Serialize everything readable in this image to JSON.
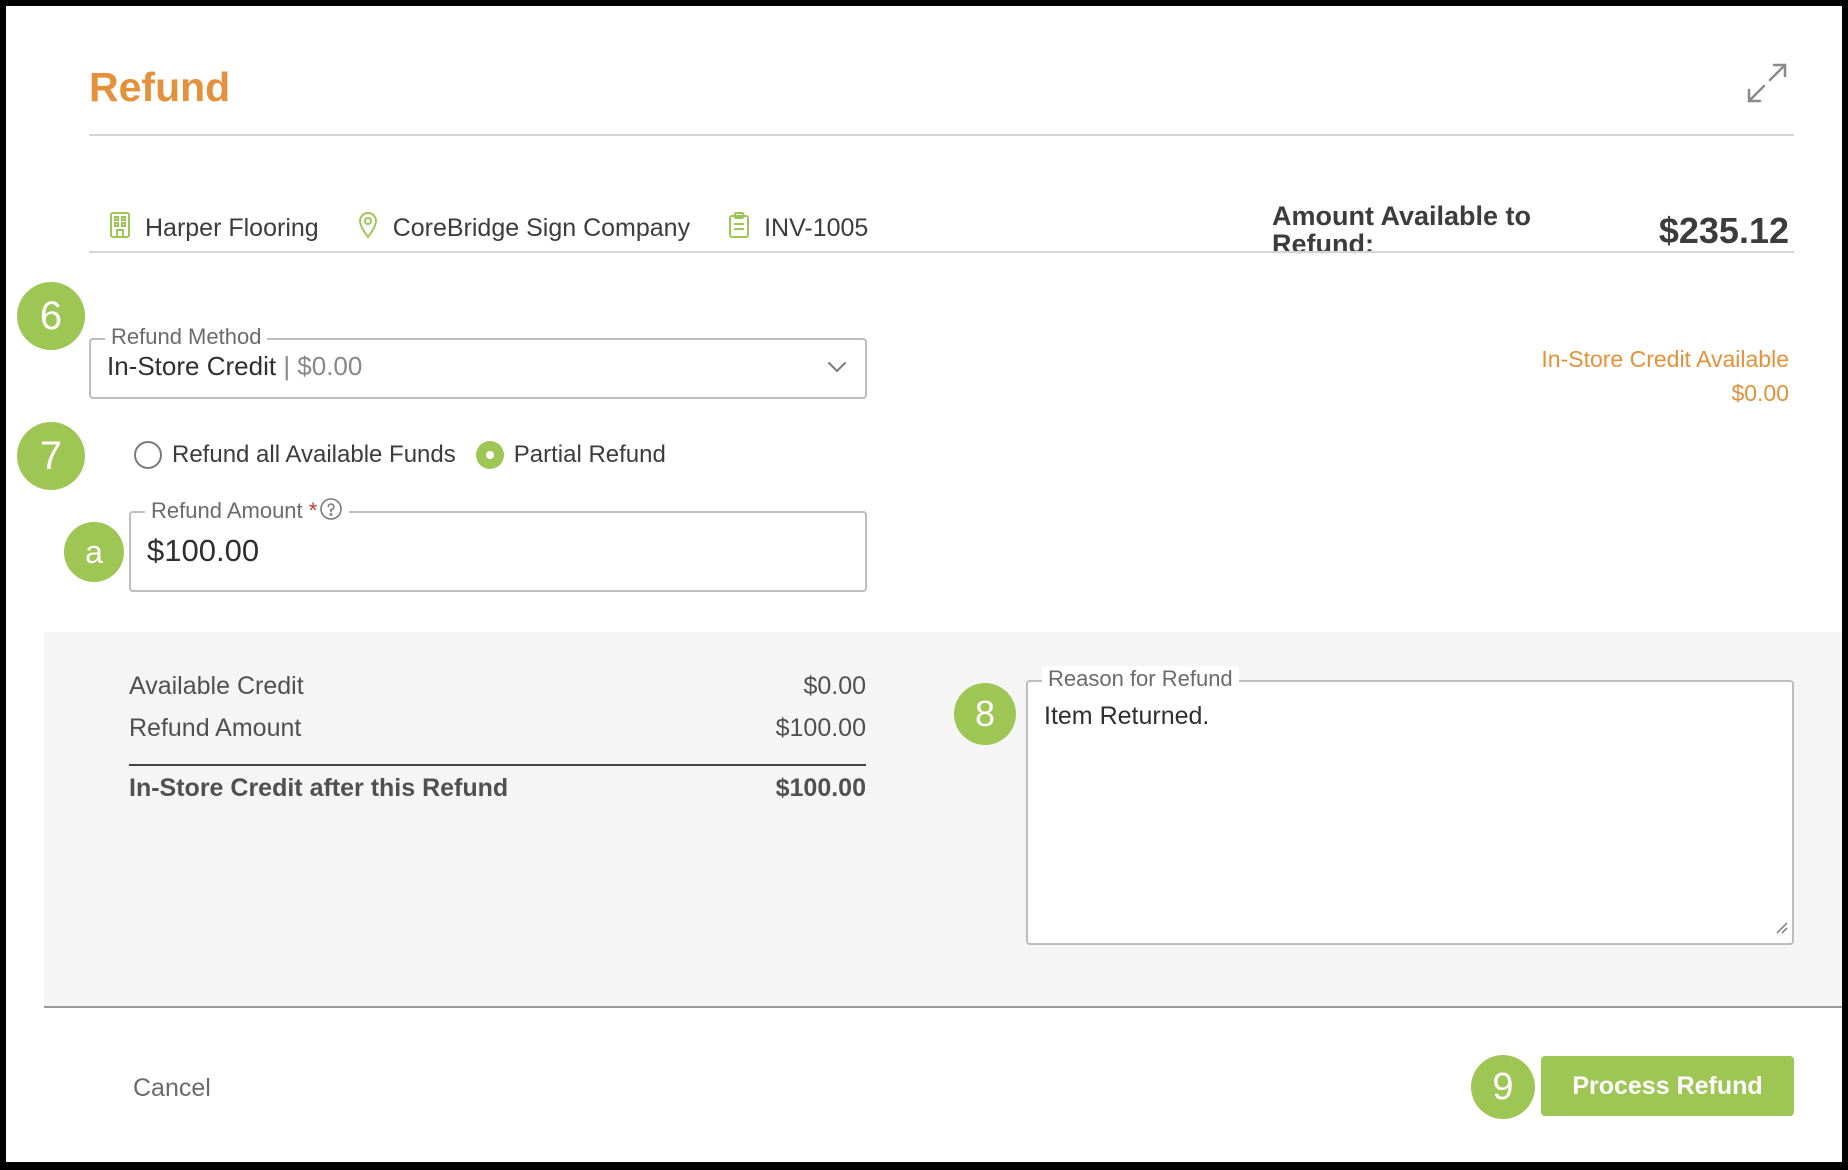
{
  "header": {
    "title": "Refund"
  },
  "info": {
    "company": "Harper Flooring",
    "location": "CoreBridge Sign Company",
    "invoice": "INV-1005",
    "available_label": "Amount Available to Refund:",
    "available_value": "$235.12"
  },
  "refund_method": {
    "legend": "Refund Method",
    "selected": "In-Store Credit",
    "selected_sub": "| $0.00"
  },
  "credit_note": {
    "label": "In-Store Credit Available",
    "value": "$0.00"
  },
  "refund_type": {
    "options": [
      "Refund all Available Funds",
      "Partial Refund"
    ],
    "selected": "Partial Refund"
  },
  "refund_amount": {
    "legend": "Refund Amount",
    "required_mark": "*",
    "value": "$100.00"
  },
  "summary": {
    "rows": [
      {
        "label": "Available Credit",
        "value": "$0.00"
      },
      {
        "label": "Refund Amount",
        "value": "$100.00"
      }
    ],
    "total": {
      "label": "In-Store Credit after this Refund",
      "value": "$100.00"
    }
  },
  "reason": {
    "legend": "Reason for Refund",
    "value": "Item Returned."
  },
  "footer": {
    "cancel_label": "Cancel",
    "process_label": "Process Refund"
  },
  "badges": {
    "method": "6",
    "type": "7",
    "amount": "a",
    "reason": "8",
    "process": "9"
  },
  "colors": {
    "accent_orange": "#e3913a",
    "accent_green": "#9ec655",
    "panel_bg": "#f5f5f5"
  },
  "icons": {
    "expand": "expand-arrows-icon",
    "company": "building-icon",
    "location": "map-pin-icon",
    "invoice": "clipboard-icon",
    "dropdown": "chevron-down-icon",
    "help": "help-circle-icon"
  }
}
